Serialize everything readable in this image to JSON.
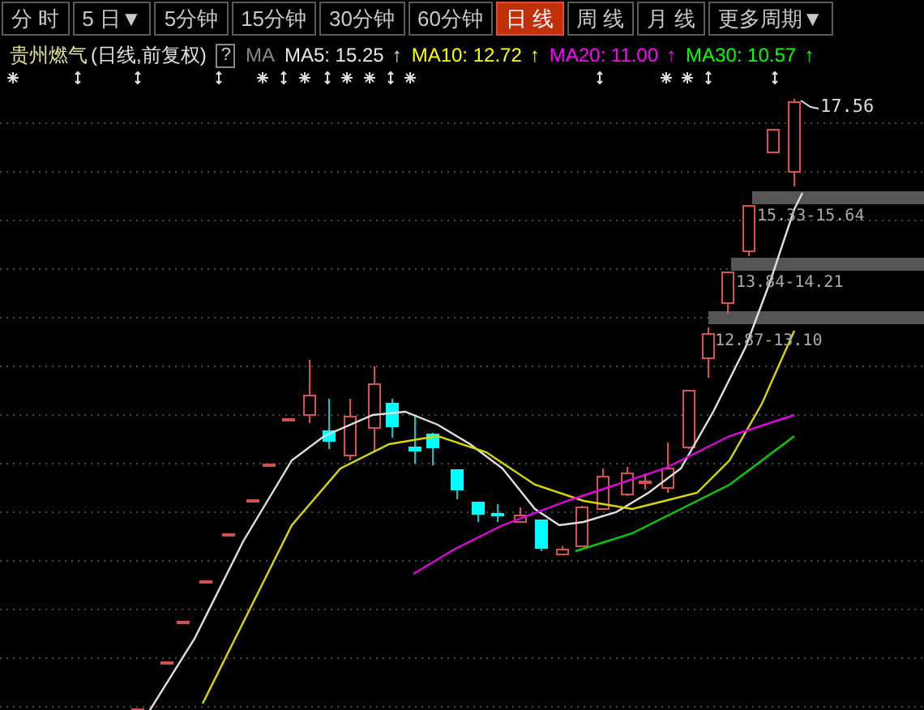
{
  "period_tabs": [
    {
      "label": "分 时",
      "selected": false
    },
    {
      "label": "5 日▼",
      "selected": false
    },
    {
      "label": "5分钟",
      "selected": false
    },
    {
      "label": "15分钟",
      "selected": false
    },
    {
      "label": "30分钟",
      "selected": false
    },
    {
      "label": "60分钟",
      "selected": false
    },
    {
      "label": "日 线",
      "selected": true
    },
    {
      "label": "周 线",
      "selected": false
    },
    {
      "label": "月 线",
      "selected": false
    },
    {
      "label": "更多周期▼",
      "selected": false
    }
  ],
  "legend": {
    "stock_name": "贵州燃气",
    "mode": "(日线,前复权)",
    "help": "?",
    "indicator": "MA",
    "averages": [
      {
        "label": "MA5: 15.25",
        "arrow": "↑",
        "color": "#e8e8e8"
      },
      {
        "label": "MA10: 12.72",
        "arrow": "↑",
        "color": "#ffff00"
      },
      {
        "label": "MA20: 11.00",
        "arrow": "↑",
        "color": "#ff00ff"
      },
      {
        "label": "MA30: 10.57",
        "arrow": "↑",
        "color": "#00ff00"
      }
    ]
  },
  "chart": {
    "high_label": "17.56",
    "zones": [
      {
        "label": "15.33-15.64"
      },
      {
        "label": "13.84-14.21"
      },
      {
        "label": "12.87-13.10"
      }
    ]
  }
}
